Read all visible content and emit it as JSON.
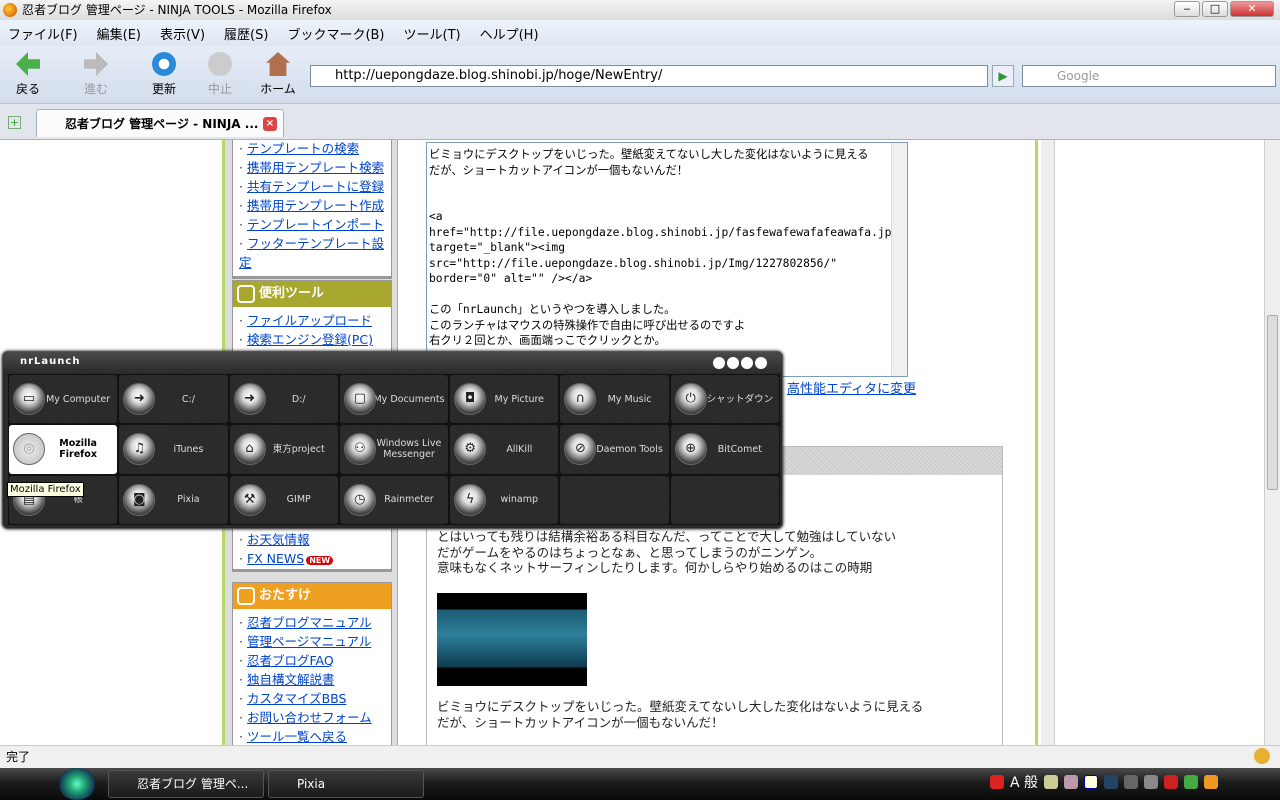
{
  "window": {
    "title": "忍者ブログ 管理ページ - NINJA TOOLS - Mozilla Firefox",
    "min": "‒",
    "max": "□",
    "close": "✕"
  },
  "menu": [
    "ファイル(F)",
    "編集(E)",
    "表示(V)",
    "履歴(S)",
    "ブックマーク(B)",
    "ツール(T)",
    "ヘルプ(H)"
  ],
  "toolbar": {
    "back": "戻る",
    "forward": "進む",
    "reload": "更新",
    "stop": "中止",
    "home": "ホーム",
    "url": "http://uepongdaze.blog.shinobi.jp/hoge/NewEntry/",
    "search_placeholder": "Google"
  },
  "tab": {
    "label": "忍者ブログ 管理ページ - NINJA ..."
  },
  "sidebar": {
    "template_links": [
      "テンプレートの検索",
      "携帯用テンプレート検索",
      "共有テンプレートに登録",
      "携帯用テンプレート作成",
      "テンプレートインポート",
      "フッターテンプレート設定"
    ],
    "tools_title": "便利ツール",
    "tools_links": [
      "ファイルアップロード",
      "検索エンジン登録(PC)"
    ],
    "info_links": [
      "お天気情報",
      "FX NEWS"
    ],
    "new_badge": "NEW",
    "help_title": "おたすけ",
    "help_links": [
      "忍者ブログマニュアル",
      "管理ページマニュアル",
      "忍者ブログFAQ",
      "独自構文解説書",
      "カスタマイズBBS",
      "お問い合わせフォーム",
      "ツール一覧へ戻る"
    ]
  },
  "editor": {
    "text": "ビミョウにデスクトップをいじった。壁紙変えてないし大した変化はないように見える\nだが、ショートカットアイコンが一個もないんだ！\n\n\n<a href=\"http://file.uepongdaze.blog.shinobi.jp/fasfewafewafafeawafa.jpg\" target=\"_blank\"><img src=\"http://file.uepongdaze.blog.shinobi.jp/Img/1227802856/\" border=\"0\" alt=\"\" /></a>\n\nこの「nrLaunch」というやつを導入しました。\nこのランチャはマウスの特殊操作で自由に呼び出せるのですよ\n右クリ２回とか、画面端っこでクリックとか。",
    "switch_link": "高性能エディタに変更"
  },
  "preview": {
    "lines1": [
      "とはいっても残りは結構余裕ある科目なんだ、ってことで大して勉強はしていない",
      "だがゲームをやるのはちょっとなぁ、と思ってしまうのがニンゲン。",
      "意味もなくネットサーフィンしたりします。何かしらやり始めるのはこの時期"
    ],
    "lines2": [
      "ビミョウにデスクトップをいじった。壁紙変えてないし大した変化はないように見える",
      "だが、ショートカットアイコンが一個もないんだ！"
    ]
  },
  "status": "完了",
  "taskbar": {
    "items": [
      "忍者ブログ 管理ペ...",
      "Pixia"
    ],
    "tray": "A 般"
  },
  "launcher": {
    "title": "nrLaunch",
    "tooltip": "Mozilla Firefox",
    "items": [
      {
        "label": "My Computer",
        "icon": "computer-icon",
        "glyph": "▭"
      },
      {
        "label": "C:/",
        "icon": "drive-icon",
        "glyph": "➜"
      },
      {
        "label": "D:/",
        "icon": "drive-icon",
        "glyph": "➜"
      },
      {
        "label": "My Documents",
        "icon": "folder-icon",
        "glyph": "▢"
      },
      {
        "label": "My Picture",
        "icon": "camera-icon",
        "glyph": "◘"
      },
      {
        "label": "My Music",
        "icon": "headphones-icon",
        "glyph": "∩"
      },
      {
        "label": "シャットダウン",
        "icon": "power-icon",
        "glyph": "⏻"
      },
      {
        "label": "Mozilla Firefox",
        "icon": "firefox-icon",
        "glyph": "◎"
      },
      {
        "label": "iTunes",
        "icon": "music-note-icon",
        "glyph": "♫"
      },
      {
        "label": "東方project",
        "icon": "gamepad-icon",
        "glyph": "⌂"
      },
      {
        "label": "Windows Live Messenger",
        "icon": "people-icon",
        "glyph": "⚇"
      },
      {
        "label": "AllKill",
        "icon": "gear-icon",
        "glyph": "⚙"
      },
      {
        "label": "Daemon Tools",
        "icon": "disc-icon",
        "glyph": "⊘"
      },
      {
        "label": "BitComet",
        "icon": "globe-icon",
        "glyph": "⊕"
      },
      {
        "label": "帳",
        "icon": "notepad-icon",
        "glyph": "▤"
      },
      {
        "label": "Pixia",
        "icon": "paint-icon",
        "glyph": "◙"
      },
      {
        "label": "GIMP",
        "icon": "hammer-icon",
        "glyph": "⚒"
      },
      {
        "label": "Rainmeter",
        "icon": "clock-icon",
        "glyph": "◷"
      },
      {
        "label": "winamp",
        "icon": "lightning-icon",
        "glyph": "ϟ"
      },
      {
        "label": "",
        "icon": "",
        "glyph": ""
      },
      {
        "label": "",
        "icon": "",
        "glyph": ""
      }
    ]
  },
  "colors": {
    "tools_header": "#a8a830",
    "help_header": "#f0a020",
    "link": "#0044cc",
    "launcher_bg": "#2a2a2a"
  }
}
